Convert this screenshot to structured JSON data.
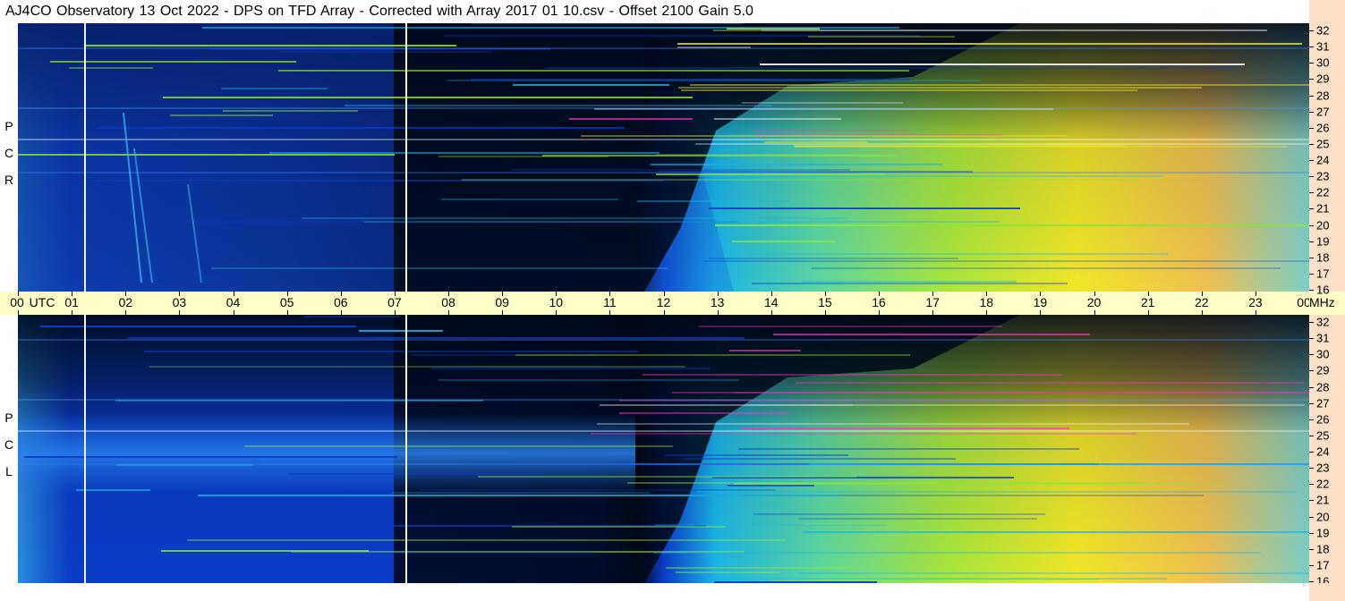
{
  "title": "AJ4CO Observatory  13 Oct 2022  -  DPS on TFD Array  -  Corrected with Array 2017 01 10.csv  -  Offset 2100  Gain 5.0",
  "panels": {
    "rcp": {
      "letters": [
        "P",
        "C",
        "R"
      ]
    },
    "lcp": {
      "letters": [
        "P",
        "C",
        "L"
      ]
    }
  },
  "time_axis": {
    "labels": [
      "00",
      "UTC",
      "01",
      "02",
      "03",
      "04",
      "05",
      "06",
      "07",
      "08",
      "09",
      "10",
      "11",
      "12",
      "13",
      "14",
      "15",
      "16",
      "17",
      "18",
      "19",
      "20",
      "21",
      "22",
      "23",
      "00"
    ],
    "hours": [
      0,
      1,
      2,
      3,
      4,
      5,
      6,
      7,
      8,
      9,
      10,
      11,
      12,
      13,
      14,
      15,
      16,
      17,
      18,
      19,
      20,
      21,
      22,
      23,
      24
    ],
    "unit_label": "MHz"
  },
  "freq_axis": {
    "labels": [
      "32",
      "31",
      "30",
      "29",
      "28",
      "27",
      "26",
      "25",
      "24",
      "23",
      "22",
      "21",
      "20",
      "19",
      "18",
      "17",
      "16"
    ],
    "min_mhz": 16,
    "max_mhz": 32
  },
  "colors": {
    "background_dark": "#000a2a",
    "low": "#0a3cc8",
    "mid": "#19b4e6",
    "high_green": "#8ce63c",
    "high_yellow": "#f0e628",
    "peak_orange": "#f0a050",
    "hot_magenta": "#ff32c8",
    "utc_band": "#ffffc8",
    "freq_axis_bg": "#fde0c8"
  }
}
